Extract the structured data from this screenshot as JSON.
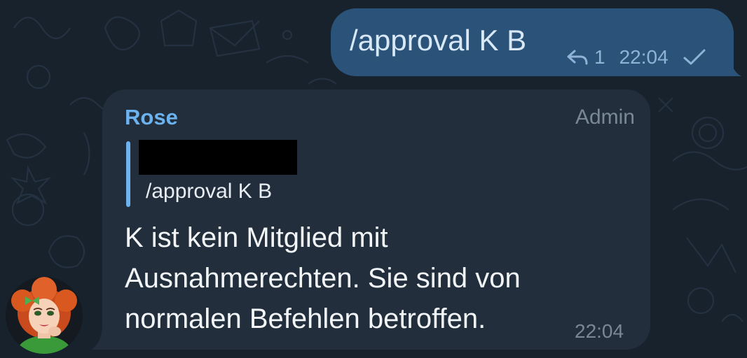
{
  "outgoing_message": {
    "text": "/approval K B",
    "reply_count": "1",
    "time": "22:04",
    "status_icon": "check-icon",
    "reply_icon": "reply-arrow-icon"
  },
  "incoming_message": {
    "sender": "Rose",
    "sender_role": "Admin",
    "quote": {
      "author": "[redacted]",
      "text": "/approval K B"
    },
    "body_lines": [
      "K ist kein Mitglied mit",
      "Ausnahmerechten. Sie sind von",
      "normalen Befehlen betroffen."
    ],
    "time": "22:04"
  },
  "colors": {
    "background": "#18222d",
    "outgoing_bubble": "#2b5278",
    "incoming_bubble": "#222e3b",
    "accent": "#6cb2ee",
    "muted": "#7a8896"
  }
}
